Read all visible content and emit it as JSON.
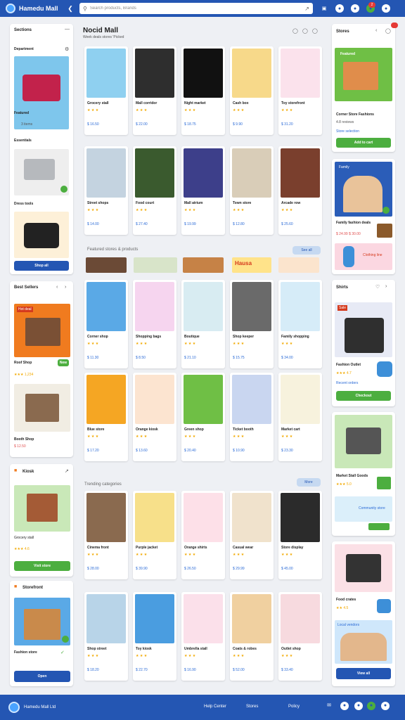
{
  "header": {
    "brand": "Hamedu Mall",
    "search_placeholder": "Search products, Brands",
    "search_icon": "search-icon",
    "icons": [
      "cart-icon",
      "bell-icon",
      "user-icon",
      "globe-icon"
    ],
    "badge": "2"
  },
  "main": {
    "title": "Nocid Mall",
    "subtitle": "Week deals stores 'Picked",
    "section2": "Featured stores & products",
    "section2_pill": "See all",
    "banner_text": "Hausa",
    "section3": "Trending categories",
    "section3_pill": "More"
  },
  "left": {
    "p1_title": "Sections",
    "p1_sub": "Department",
    "p1_item1": "Featured",
    "p1_item1_meta": "3 items",
    "p1_item2": "Essentials",
    "p1_item3": "Dress tools",
    "p1_button": "Shop all",
    "p2_title": "Best Sellers",
    "p2_badge": "Hot deal",
    "p2_label": "Roof Shop",
    "p2_tag": "New",
    "p2_rating": "★★★ 1,234",
    "p2_label2": "Booth Shop",
    "p2_price": "$ 12.50",
    "p3_title": "Kiosk",
    "p3_meta": "Grocery stall",
    "p3_rating": "★★★ 4.6",
    "p3_button": "Visit store",
    "p4_title": "Storefront",
    "p4_name": "Fashion store",
    "p4_button": "Open"
  },
  "right": {
    "r1_title": "Stores",
    "r1_promo": "Featured",
    "r1_name": "Corner Store Fashions",
    "r1_meta": "4.8 reviews",
    "r1_sub": "Store selection",
    "r1_button": "Add to cart",
    "r2_title": "Family",
    "r2_name": "Family fashion deals",
    "r2_price": "$ 24.99 $ 30.00",
    "r2_sub": "Clothing line",
    "r3_title": "Shirts",
    "r3_badge": "Sale",
    "r3_name": "Fashion Outlet",
    "r3_meta": "★★★ 4.7",
    "r3_sub": "Recent orders",
    "r3_button": "Checkout",
    "r4_name": "Market Stall Goods",
    "r4_meta": "★★★ 5.0",
    "r4_sub": "Community store",
    "r5_name": "Food crates",
    "r5_meta": "★★ 4.5",
    "r5_sub": "Local vendors",
    "r5_button": "View all"
  },
  "products": [
    {
      "name": "Grocery stall",
      "rating": "★ ★ ★",
      "price": "$ 16.50"
    },
    {
      "name": "Mall corridor",
      "rating": "★ ★ ★",
      "price": "$ 22.00"
    },
    {
      "name": "Night market",
      "rating": "★ ★ ★",
      "price": "$ 18.75"
    },
    {
      "name": "Cash box",
      "rating": "★ ★ ★",
      "price": "$ 9.90"
    },
    {
      "name": "Toy storefront",
      "rating": "★ ★ ★",
      "price": "$ 31.20"
    },
    {
      "name": "Street shops",
      "rating": "★ ★ ★",
      "price": "$ 14.00"
    },
    {
      "name": "Food court",
      "rating": "★ ★ ★",
      "price": "$ 27.40"
    },
    {
      "name": "Mall atrium",
      "rating": "★ ★ ★",
      "price": "$ 19.99"
    },
    {
      "name": "Town store",
      "rating": "★ ★ ★",
      "price": "$ 12.80"
    },
    {
      "name": "Arcade row",
      "rating": "★ ★ ★",
      "price": "$ 25.60"
    },
    {
      "name": "Corner shop",
      "rating": "★ ★ ★",
      "price": "$ 11.30"
    },
    {
      "name": "Shopping bags",
      "rating": "★ ★ ★",
      "price": "$ 8.50"
    },
    {
      "name": "Boutique",
      "rating": "★ ★ ★",
      "price": "$ 21.10"
    },
    {
      "name": "Shop keeper",
      "rating": "★ ★ ★",
      "price": "$ 15.75"
    },
    {
      "name": "Family shopping",
      "rating": "★ ★ ★",
      "price": "$ 34.00"
    },
    {
      "name": "Blue store",
      "rating": "★ ★ ★",
      "price": "$ 17.20"
    },
    {
      "name": "Orange kiosk",
      "rating": "★ ★ ★",
      "price": "$ 13.60"
    },
    {
      "name": "Green shop",
      "rating": "★ ★ ★",
      "price": "$ 20.40"
    },
    {
      "name": "Ticket booth",
      "rating": "★ ★ ★",
      "price": "$ 10.90"
    },
    {
      "name": "Market cart",
      "rating": "★ ★ ★",
      "price": "$ 23.30"
    },
    {
      "name": "Cinema front",
      "rating": "★ ★ ★",
      "price": "$ 28.00"
    },
    {
      "name": "Purple jacket",
      "rating": "★ ★ ★",
      "price": "$ 39.90"
    },
    {
      "name": "Orange shirts",
      "rating": "★ ★ ★",
      "price": "$ 26.50"
    },
    {
      "name": "Casual wear",
      "rating": "★ ★ ★",
      "price": "$ 29.99"
    },
    {
      "name": "Store display",
      "rating": "★ ★ ★",
      "price": "$ 45.00"
    },
    {
      "name": "Shop street",
      "rating": "★ ★ ★",
      "price": "$ 18.20"
    },
    {
      "name": "Toy kiosk",
      "rating": "★ ★ ★",
      "price": "$ 22.70"
    },
    {
      "name": "Umbrella stall",
      "rating": "★ ★ ★",
      "price": "$ 16.90"
    },
    {
      "name": "Coats & robes",
      "rating": "★ ★ ★",
      "price": "$ 52.00"
    },
    {
      "name": "Outlet shop",
      "rating": "★ ★ ★",
      "price": "$ 33.40"
    }
  ],
  "footer": {
    "brand": "Hamedu Mall Ltd",
    "links": [
      "Help Center",
      "Stores",
      "Policy"
    ]
  },
  "colors": {
    "primary": "#2456b3",
    "accent": "#4cae3f"
  }
}
